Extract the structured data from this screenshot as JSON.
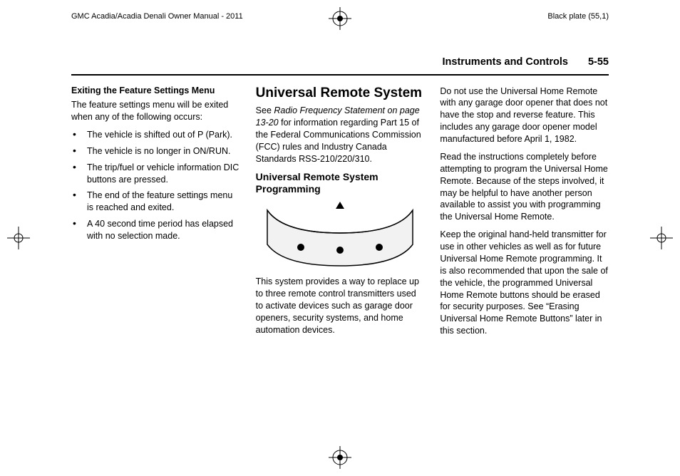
{
  "header": {
    "manual_title": "GMC Acadia/Acadia Denali Owner Manual - 2011",
    "plate_label": "Black plate (55,1)"
  },
  "running_head": {
    "chapter": "Instruments and Controls",
    "page_number": "5-55"
  },
  "col1": {
    "heading": "Exiting the Feature Settings Menu",
    "intro": "The feature settings menu will be exited when any of the following occurs:",
    "bullets": [
      "The vehicle is shifted out of P (Park).",
      "The vehicle is no longer in ON/RUN.",
      "The trip/fuel or vehicle information DIC buttons are pressed.",
      "The end of the feature settings menu is reached and exited.",
      "A 40 second time period has elapsed with no selection made."
    ]
  },
  "col2": {
    "title": "Universal Remote System",
    "see_prefix": "See ",
    "see_ref": "Radio Frequency Statement on page 13-20",
    "see_suffix": " for information regarding Part 15 of the Federal Communications Commission (FCC) rules and Industry Canada Standards RSS-210/220/310.",
    "subhead": "Universal Remote System Programming",
    "caption": "This system provides a way to replace up to three remote control transmitters used to activate devices such as garage door openers, security systems, and home automation devices."
  },
  "col3": {
    "p1": "Do not use the Universal Home Remote with any garage door opener that does not have the stop and reverse feature. This includes any garage door opener model manufactured before April 1, 1982.",
    "p2": "Read the instructions completely before attempting to program the Universal Home Remote. Because of the steps involved, it may be helpful to have another person available to assist you with programming the Universal Home Remote.",
    "p3": "Keep the original hand-held transmitter for use in other vehicles as well as for future Universal Home Remote programming. It is also recommended that upon the sale of the vehicle, the programmed Universal Home Remote buttons should be erased for security purposes. See “Erasing Universal Home Remote Buttons” later in this section."
  }
}
